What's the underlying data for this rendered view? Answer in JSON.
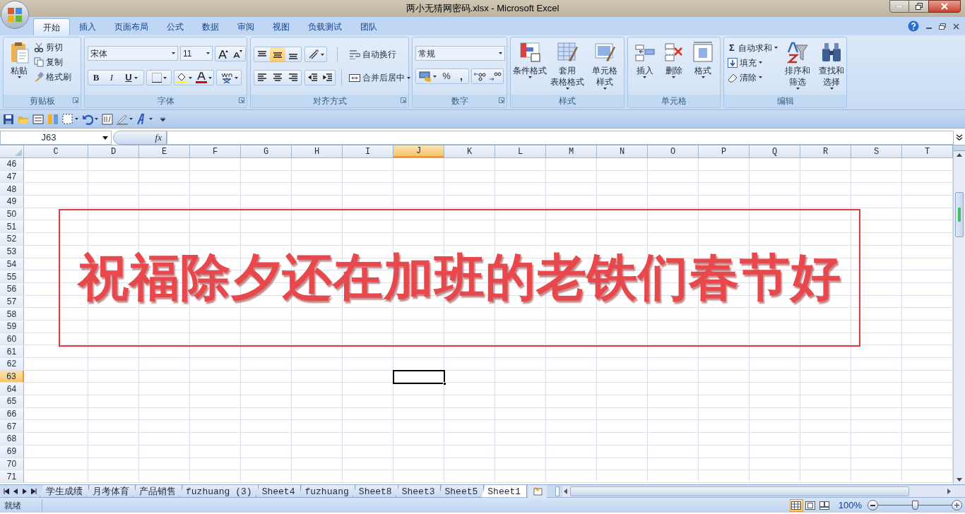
{
  "window": {
    "title": "两小无猜网密码.xlsx - Microsoft Excel"
  },
  "ribbon_tabs": [
    {
      "label": "开始",
      "selected": true
    },
    {
      "label": "插入",
      "selected": false
    },
    {
      "label": "页面布局",
      "selected": false
    },
    {
      "label": "公式",
      "selected": false
    },
    {
      "label": "数据",
      "selected": false
    },
    {
      "label": "审阅",
      "selected": false
    },
    {
      "label": "视图",
      "selected": false
    },
    {
      "label": "负载测试",
      "selected": false
    },
    {
      "label": "团队",
      "selected": false
    }
  ],
  "clipboard": {
    "label": "剪贴板",
    "paste": "粘贴",
    "cut": "剪切",
    "copy": "复制",
    "format_painter": "格式刷"
  },
  "font": {
    "label": "字体",
    "font_name": "宋体",
    "font_size": "11",
    "bold": "B",
    "italic": "I",
    "underline": "U"
  },
  "alignment": {
    "label": "对齐方式",
    "vertical": [
      {
        "kind": "top",
        "selected": false
      },
      {
        "kind": "middle",
        "selected": true
      },
      {
        "kind": "bottom",
        "selected": false
      }
    ],
    "wrap_text": "自动换行",
    "merge_center": "合并后居中"
  },
  "number": {
    "label": "数字",
    "format": "常规",
    "percent": "%",
    "comma": ","
  },
  "styles": {
    "label": "样式",
    "buttons": [
      {
        "kind": "conditional",
        "lines": [
          "条件格式"
        ]
      },
      {
        "kind": "table",
        "lines": [
          "套用",
          "表格格式"
        ]
      },
      {
        "kind": "cell",
        "lines": [
          "单元格",
          "样式"
        ]
      }
    ]
  },
  "cells": {
    "label": "单元格",
    "buttons": [
      {
        "kind": "insert",
        "label": "插入"
      },
      {
        "kind": "delete",
        "label": "删除"
      },
      {
        "kind": "format",
        "label": "格式"
      }
    ]
  },
  "editing": {
    "label": "编辑",
    "autosum_symbol": "Σ",
    "autosum": "自动求和",
    "fill": "填充",
    "clear": "清除",
    "sort_filter": [
      "排序和",
      "筛选"
    ],
    "find_select": [
      "查找和",
      "选择"
    ]
  },
  "name_box": "J63",
  "fx": "fx",
  "columns": [
    {
      "label": "C",
      "selected": false
    },
    {
      "label": "D",
      "selected": false
    },
    {
      "label": "E",
      "selected": false
    },
    {
      "label": "F",
      "selected": false
    },
    {
      "label": "G",
      "selected": false
    },
    {
      "label": "H",
      "selected": false
    },
    {
      "label": "I",
      "selected": false
    },
    {
      "label": "J",
      "selected": true
    },
    {
      "label": "K",
      "selected": false
    },
    {
      "label": "L",
      "selected": false
    },
    {
      "label": "M",
      "selected": false
    },
    {
      "label": "N",
      "selected": false
    },
    {
      "label": "O",
      "selected": false
    },
    {
      "label": "P",
      "selected": false
    },
    {
      "label": "Q",
      "selected": false
    },
    {
      "label": "R",
      "selected": false
    },
    {
      "label": "S",
      "selected": false
    },
    {
      "label": "T",
      "selected": false
    }
  ],
  "rows": [
    {
      "label": "46",
      "selected": false
    },
    {
      "label": "47",
      "selected": false
    },
    {
      "label": "48",
      "selected": false
    },
    {
      "label": "49",
      "selected": false
    },
    {
      "label": "50",
      "selected": false
    },
    {
      "label": "51",
      "selected": false
    },
    {
      "label": "52",
      "selected": false
    },
    {
      "label": "53",
      "selected": false
    },
    {
      "label": "54",
      "selected": false
    },
    {
      "label": "55",
      "selected": false
    },
    {
      "label": "56",
      "selected": false
    },
    {
      "label": "57",
      "selected": false
    },
    {
      "label": "58",
      "selected": false
    },
    {
      "label": "59",
      "selected": false
    },
    {
      "label": "60",
      "selected": false
    },
    {
      "label": "61",
      "selected": false
    },
    {
      "label": "62",
      "selected": false
    },
    {
      "label": "63",
      "selected": true
    },
    {
      "label": "64",
      "selected": false
    },
    {
      "label": "65",
      "selected": false
    },
    {
      "label": "66",
      "selected": false
    },
    {
      "label": "67",
      "selected": false
    },
    {
      "label": "68",
      "selected": false
    },
    {
      "label": "69",
      "selected": false
    },
    {
      "label": "70",
      "selected": false
    },
    {
      "label": "71",
      "selected": false
    }
  ],
  "banner": {
    "text": "祝福除夕还在加班的老铁们春节好"
  },
  "sheet_tabs": [
    {
      "label": "学生成绩",
      "selected": false
    },
    {
      "label": "月考体育",
      "selected": false
    },
    {
      "label": "产品销售",
      "selected": false
    },
    {
      "label": "fuzhuang (3)",
      "selected": false
    },
    {
      "label": "Sheet4",
      "selected": false
    },
    {
      "label": "fuzhuang",
      "selected": false
    },
    {
      "label": "Sheet8",
      "selected": false
    },
    {
      "label": "Sheet3",
      "selected": false
    },
    {
      "label": "Sheet5",
      "selected": false
    },
    {
      "label": "Sheet1",
      "selected": true
    }
  ],
  "status_bar": {
    "status": "就绪",
    "views": [
      {
        "kind": "normal",
        "selected": true
      },
      {
        "kind": "layout",
        "selected": false
      },
      {
        "kind": "pagebreak",
        "selected": false
      }
    ],
    "zoom": "100%",
    "zoom_slider": {
      "level": 0.5
    }
  }
}
